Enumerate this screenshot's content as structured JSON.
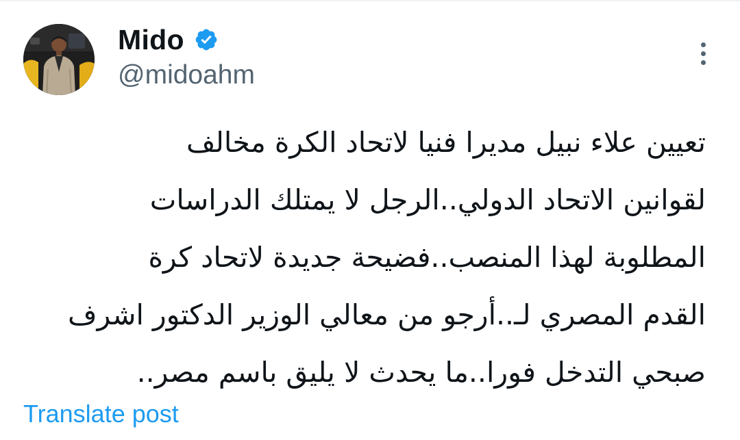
{
  "author": {
    "display_name": "Mido",
    "handle": "@midoahm",
    "verified": true,
    "avatar_icon": "profile-photo"
  },
  "post": {
    "text": "تعيين علاء نبيل مديرا فنيا لاتحاد الكرة مخالف\nلقوانين الاتحاد الدولي..الرجل لا يمتلك الدراسات\nالمطلوبة لهذا المنصب..فضيحة جديدة لاتحاد كرة\nالقدم المصري لـ..أرجو من معالي الوزير الدكتور اشرف\nصبحي التدخل فورا..ما يحدث لا يليق باسم مصر.."
  },
  "actions": {
    "translate_label": "Translate post",
    "more_icon": "more-vertical-icon"
  },
  "colors": {
    "text_primary": "#0f1419",
    "text_secondary": "#536471",
    "link": "#1d9bf0",
    "verified_badge": "#1d9bf0"
  }
}
